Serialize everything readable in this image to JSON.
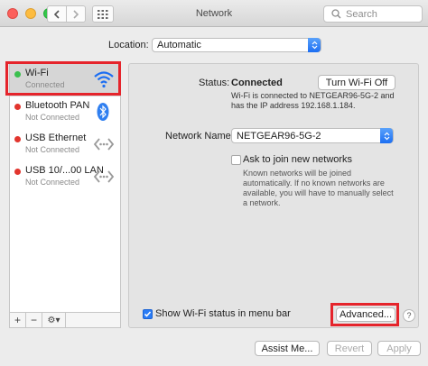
{
  "window": {
    "title": "Network"
  },
  "search": {
    "placeholder": "Search"
  },
  "location": {
    "label": "Location:",
    "value": "Automatic"
  },
  "services": [
    {
      "name": "Wi-Fi",
      "status": "Connected",
      "dot": "green",
      "icon": "wifi-icon"
    },
    {
      "name": "Bluetooth PAN",
      "status": "Not Connected",
      "dot": "red",
      "icon": "bluetooth-icon"
    },
    {
      "name": "USB Ethernet",
      "status": "Not Connected",
      "dot": "red",
      "icon": "ethernet-icon"
    },
    {
      "name": "USB 10/...00 LAN",
      "status": "Not Connected",
      "dot": "red",
      "icon": "ethernet-icon"
    }
  ],
  "sidebar_buttons": {
    "add": "+",
    "remove": "−",
    "gear": "⚙▾"
  },
  "detail": {
    "status_label": "Status:",
    "status_value": "Connected",
    "turn_off_label": "Turn Wi-Fi Off",
    "status_desc": "Wi-Fi is connected to NETGEAR96-5G-2 and has the IP address 192.168.1.184.",
    "network_name_label": "Network Name:",
    "network_name_value": "NETGEAR96-5G-2",
    "ask_label": "Ask to join new networks",
    "ask_desc": "Known networks will be joined automatically. If no known networks are available, you will have to manually select a network.",
    "show_status_label": "Show Wi-Fi status in menu bar",
    "advanced_label": "Advanced...",
    "help_label": "?"
  },
  "footer": {
    "assist_label": "Assist Me...",
    "revert_label": "Revert",
    "apply_label": "Apply"
  },
  "colors": {
    "accent": "#1c6ef2",
    "highlight": "#e5242b",
    "connected": "#3bc04e",
    "disconnected": "#e2352e"
  }
}
